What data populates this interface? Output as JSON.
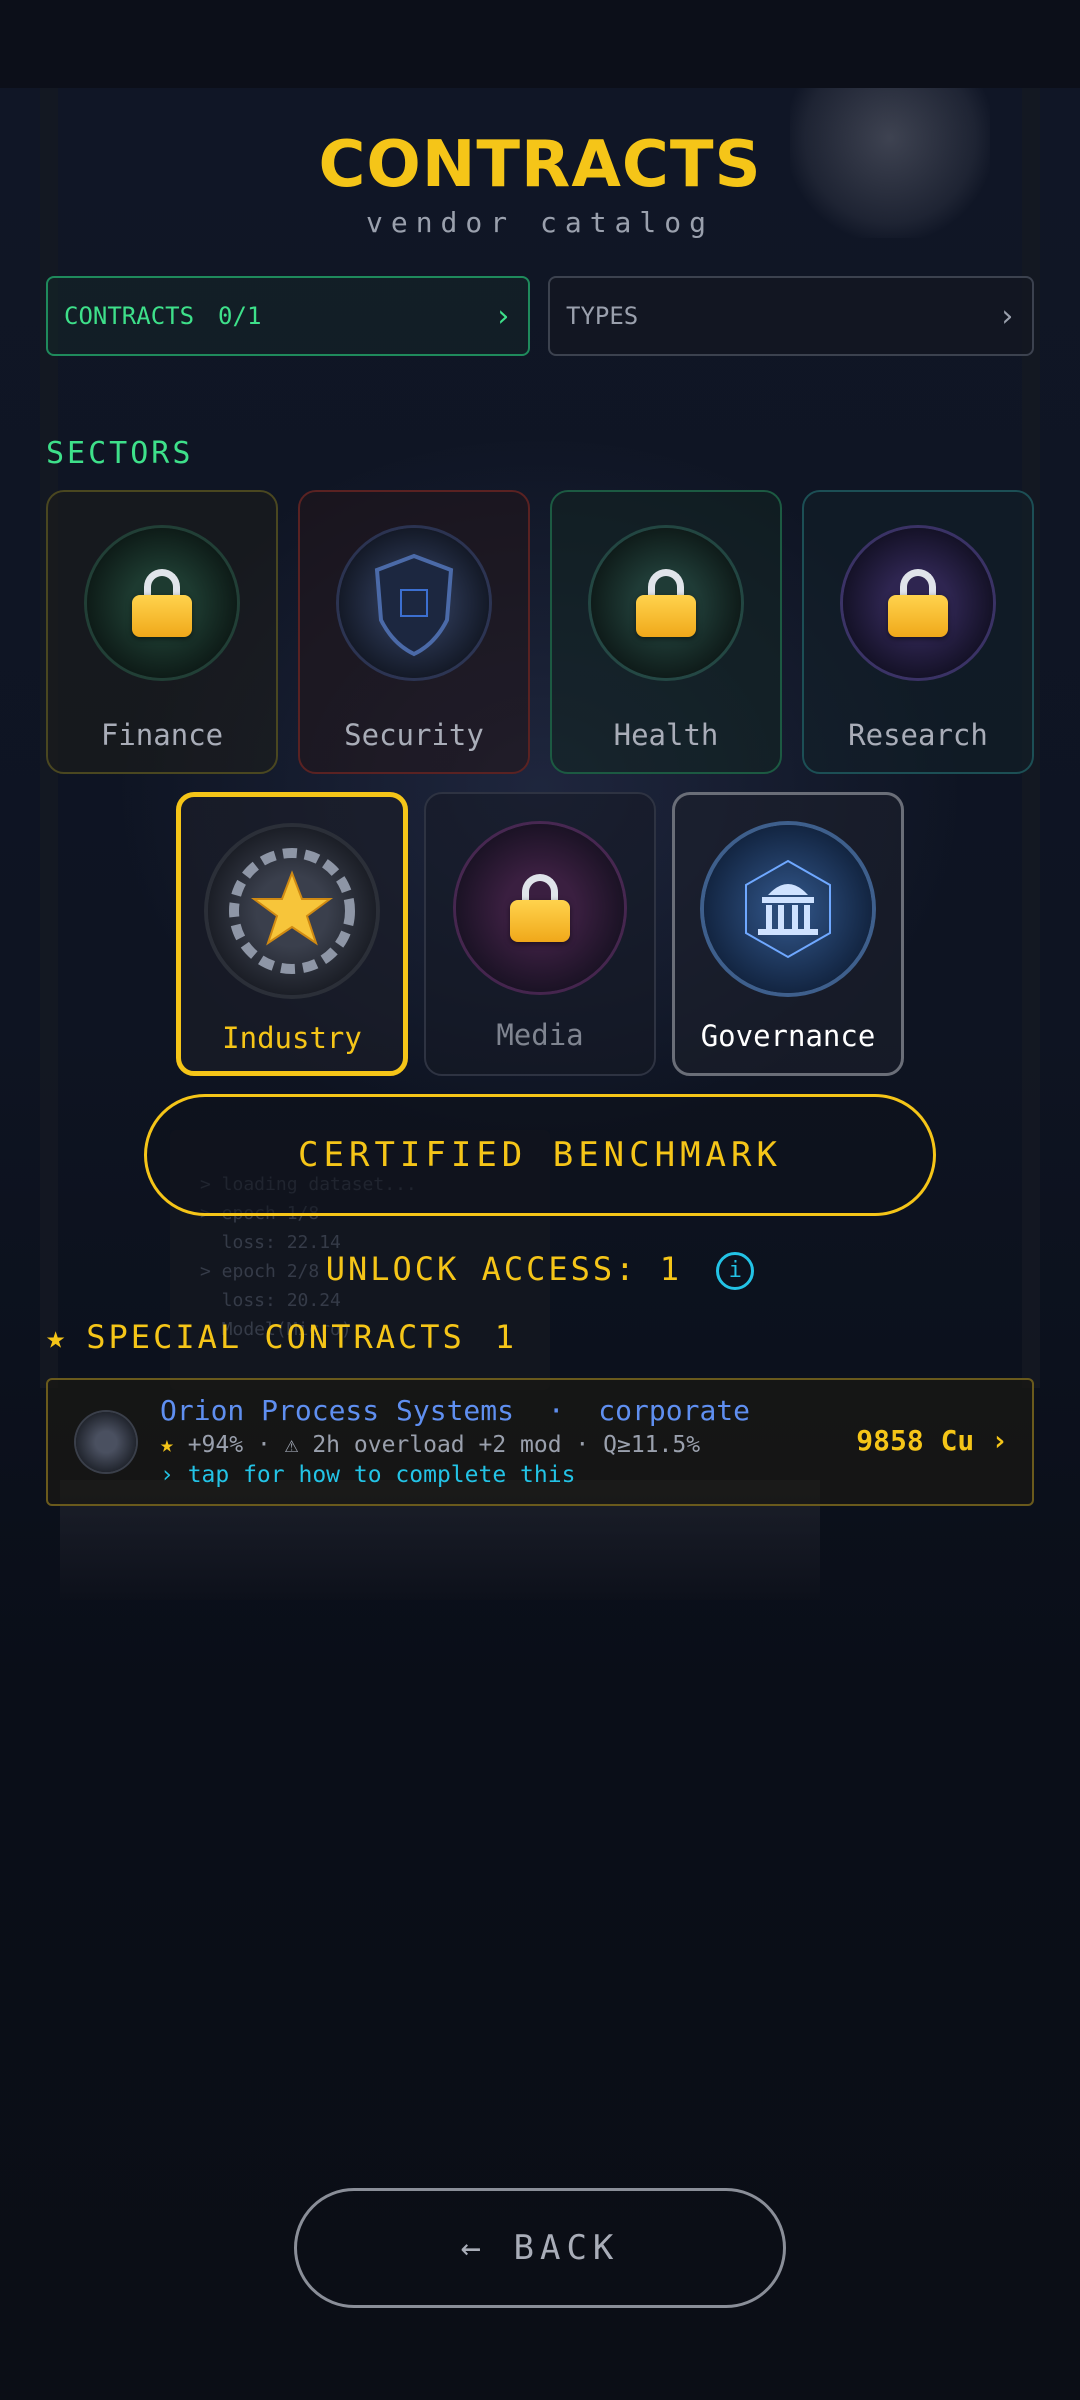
{
  "header": {
    "title": "CONTRACTS",
    "subtitle": "vendor catalog"
  },
  "filters": {
    "contracts_label": "CONTRACTS",
    "contracts_count": "0/1",
    "types_label": "TYPES",
    "chevron": "›"
  },
  "sectors": {
    "title": "SECTORS",
    "items": [
      {
        "label": "Finance",
        "locked": true,
        "icon": "finance-chart-icon"
      },
      {
        "label": "Security",
        "locked": false,
        "icon": "shield-icon"
      },
      {
        "label": "Health",
        "locked": true,
        "icon": "dna-heartbeat-icon"
      },
      {
        "label": "Research",
        "locked": true,
        "icon": "atom-icon"
      },
      {
        "label": "Industry",
        "locked": false,
        "selected": true,
        "icon": "gear-star-icon"
      },
      {
        "label": "Media",
        "locked": true,
        "icon": "soundwave-icon"
      },
      {
        "label": "Governance",
        "locked": false,
        "icon": "capitol-building-icon"
      }
    ]
  },
  "benchmark_button": "CERTIFIED BENCHMARK",
  "unlock": {
    "label": "UNLOCK ACCESS:",
    "value": "1",
    "info_icon": "i"
  },
  "special": {
    "star": "★",
    "title": "SPECIAL CONTRACTS",
    "count": "1"
  },
  "contract_card": {
    "name_line": "Orion Process Systems  ·  corporate",
    "star": "★",
    "stats_line": " +94% · ⚠ 2h overload +2 mod · Q≥11.5%",
    "hint": "› tap for how to complete this",
    "price": "9858 Cu ›"
  },
  "back_button": "← BACK",
  "colors": {
    "accent_gold": "#f5c518",
    "accent_green": "#3ee08a",
    "accent_cyan": "#23c3e6",
    "link_blue": "#5f8ff0"
  }
}
